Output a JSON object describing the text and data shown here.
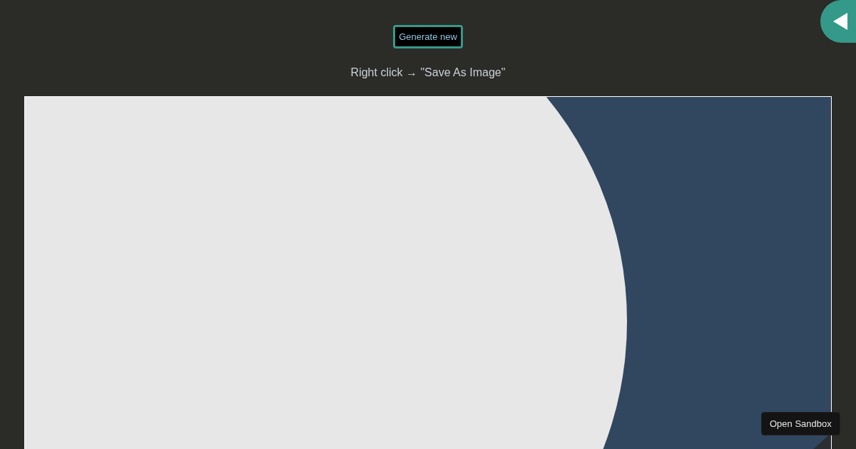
{
  "generate_button": {
    "label": "Generate new"
  },
  "instruction": "Right click → \"Save As Image\"",
  "sandbox_button": {
    "label": "Open Sandbox"
  }
}
